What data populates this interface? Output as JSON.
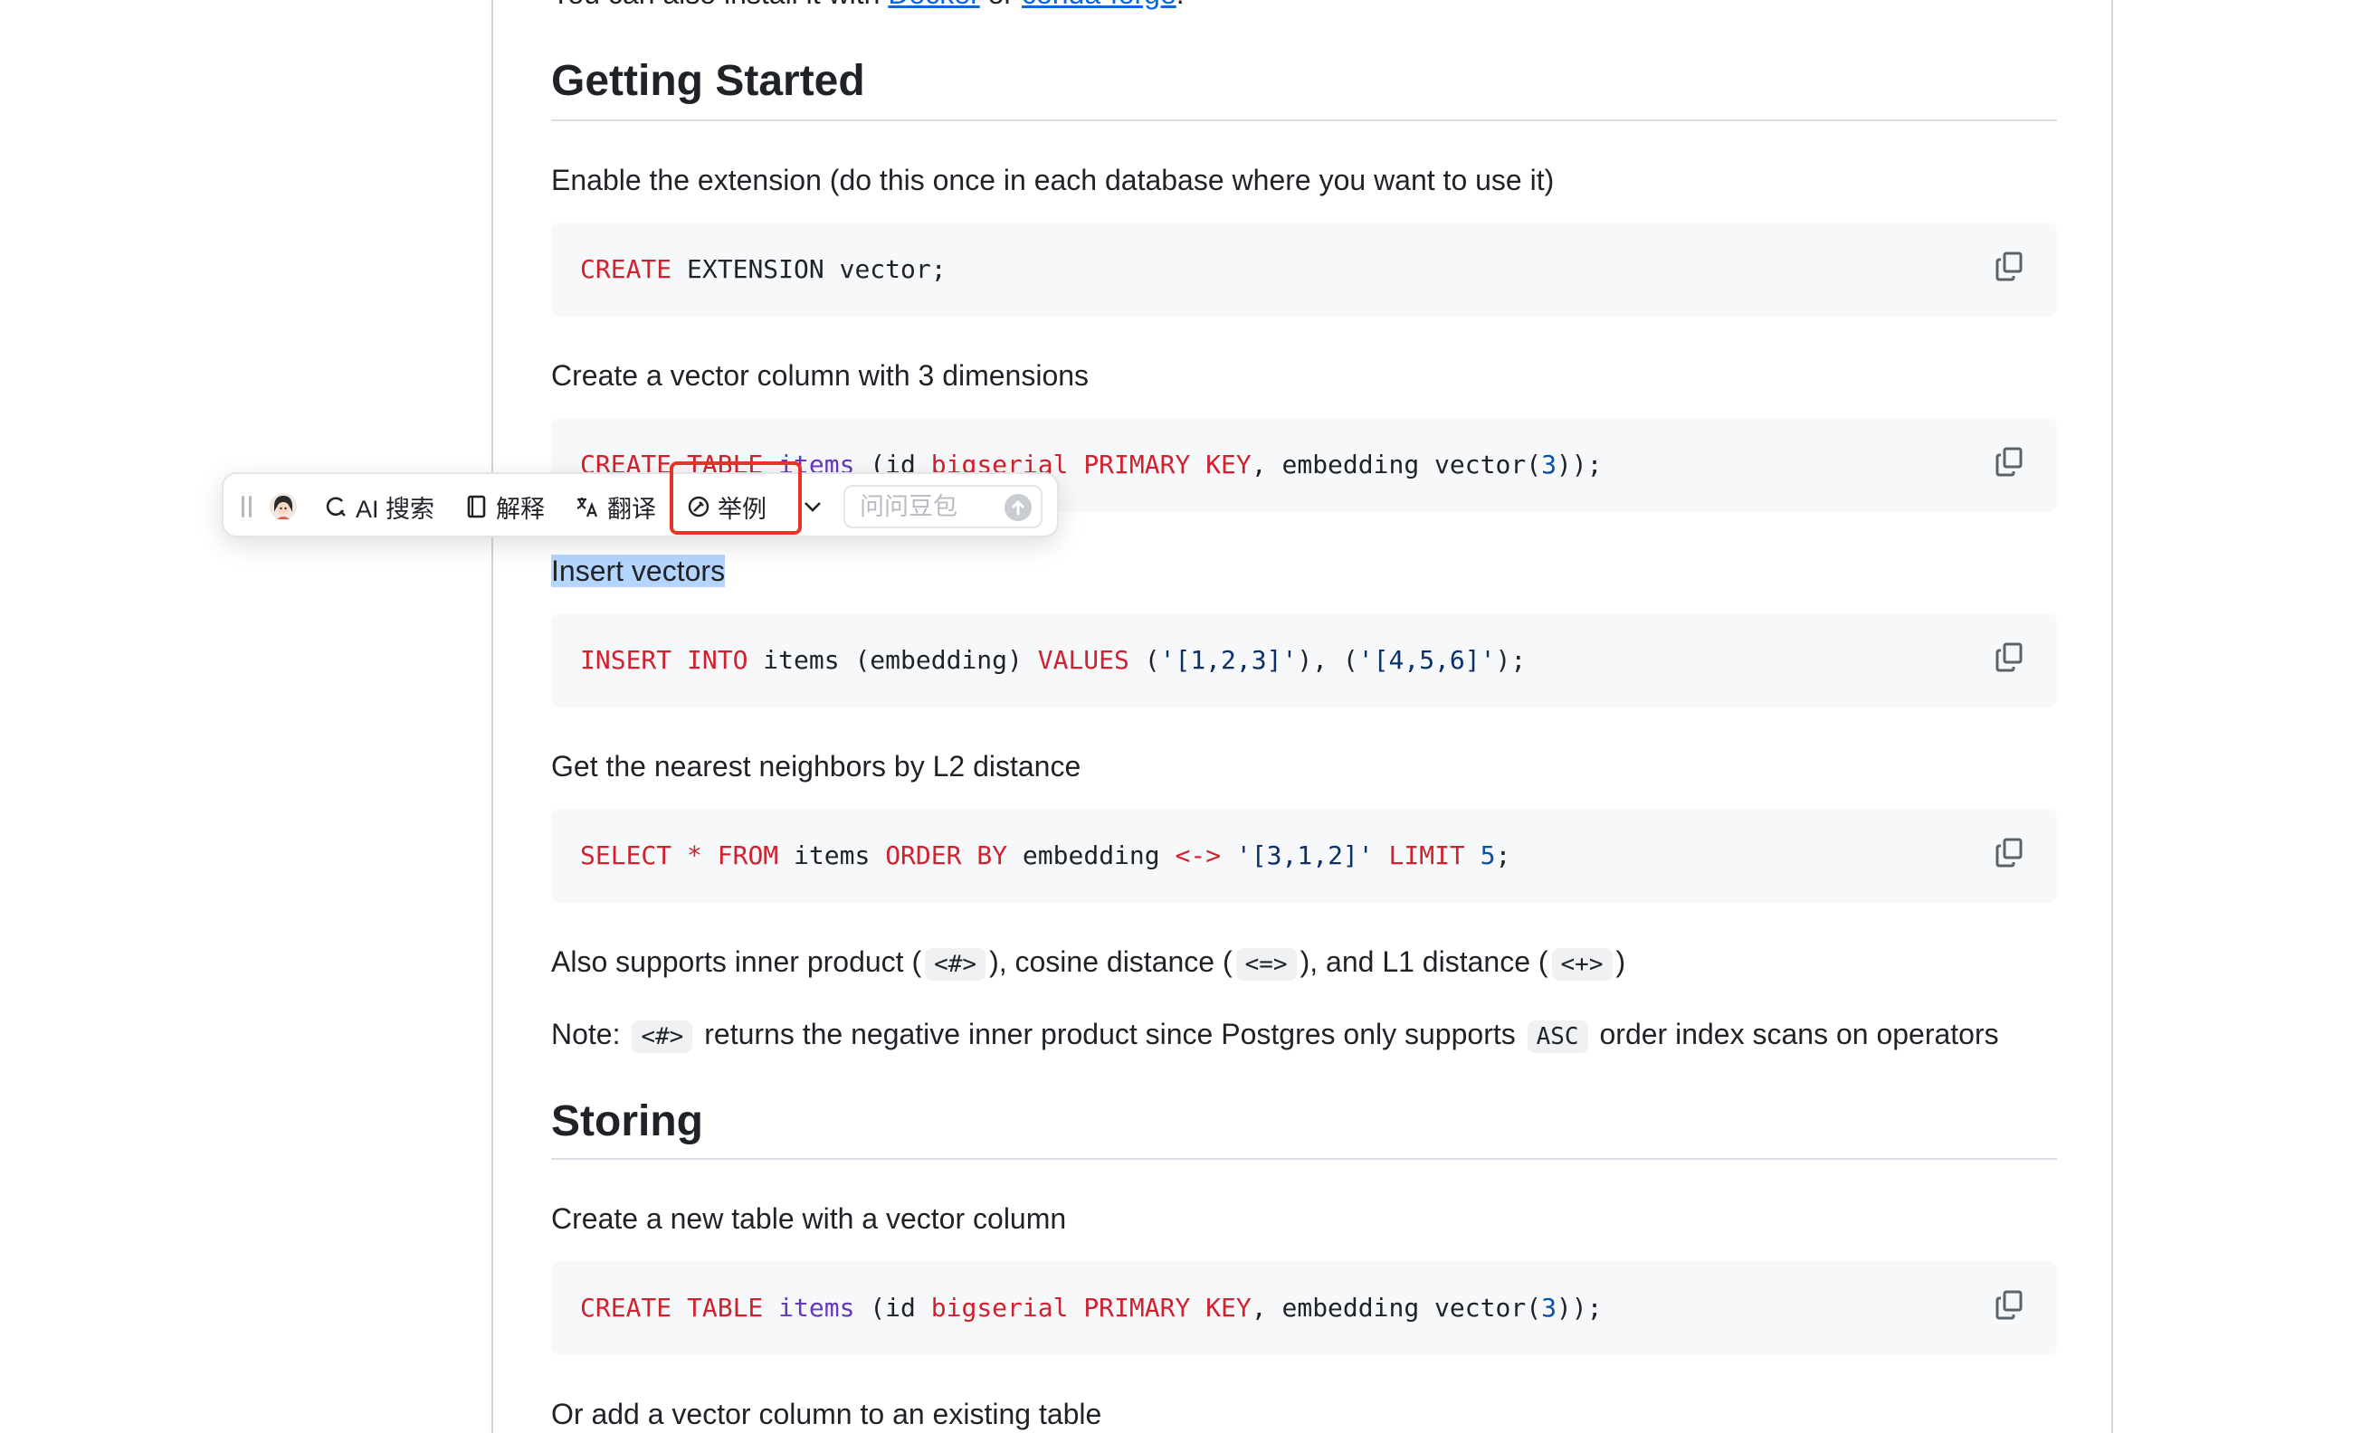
{
  "intro": {
    "prefix": "You can also install it with ",
    "docker": "Docker",
    "or": " or ",
    "conda": "conda-forge",
    "suffix": "."
  },
  "getting_started": {
    "heading": "Getting Started",
    "enable_text": "Enable the extension (do this once in each database where you want to use it)",
    "create_col_text": "Create a vector column with 3 dimensions",
    "insert_text": "Insert vectors",
    "nearest_text": "Get the nearest neighbors by L2 distance",
    "also_supports": {
      "a": "Also supports inner product (",
      "op1": "<#>",
      "b": "), cosine distance (",
      "op2": "<=>",
      "c": "), and L1 distance (",
      "op3": "<+>",
      "d": ")"
    },
    "note": {
      "a": "Note: ",
      "op": "<#>",
      "b": " returns the negative inner product since Postgres only supports ",
      "asc": "ASC",
      "c": " order index scans on operators"
    }
  },
  "storing": {
    "heading": "Storing",
    "new_table_text": "Create a new table with a vector column",
    "add_col_text": "Or add a vector column to an existing table"
  },
  "code": {
    "ext": [
      "CREATE",
      " EXTENSION vector;"
    ],
    "table": [
      "CREATE TABLE",
      " ",
      "items",
      " (id ",
      "bigserial",
      " ",
      "PRIMARY KEY",
      ", embedding vector(",
      "3",
      "));"
    ],
    "insert": [
      "INSERT INTO",
      " items (embedding) ",
      "VALUES",
      " (",
      "'[1,2,3]'",
      "), (",
      "'[4,5,6]'",
      ");"
    ],
    "select": [
      "SELECT",
      " ",
      "*",
      " ",
      "FROM",
      " items ",
      "ORDER BY",
      " embedding ",
      "<->",
      " ",
      "'[3,1,2]'",
      " ",
      "LIMIT",
      " ",
      "5",
      ";"
    ]
  },
  "toolbar": {
    "ai_search": "AI 搜索",
    "explain": "解释",
    "translate": "翻译",
    "example": "举例",
    "ask_placeholder": "问问豆包"
  },
  "colors": {
    "keyword": "#cf222e",
    "link": "#0969da",
    "selection": "#b4d5fe",
    "highlight": "#e53528"
  }
}
